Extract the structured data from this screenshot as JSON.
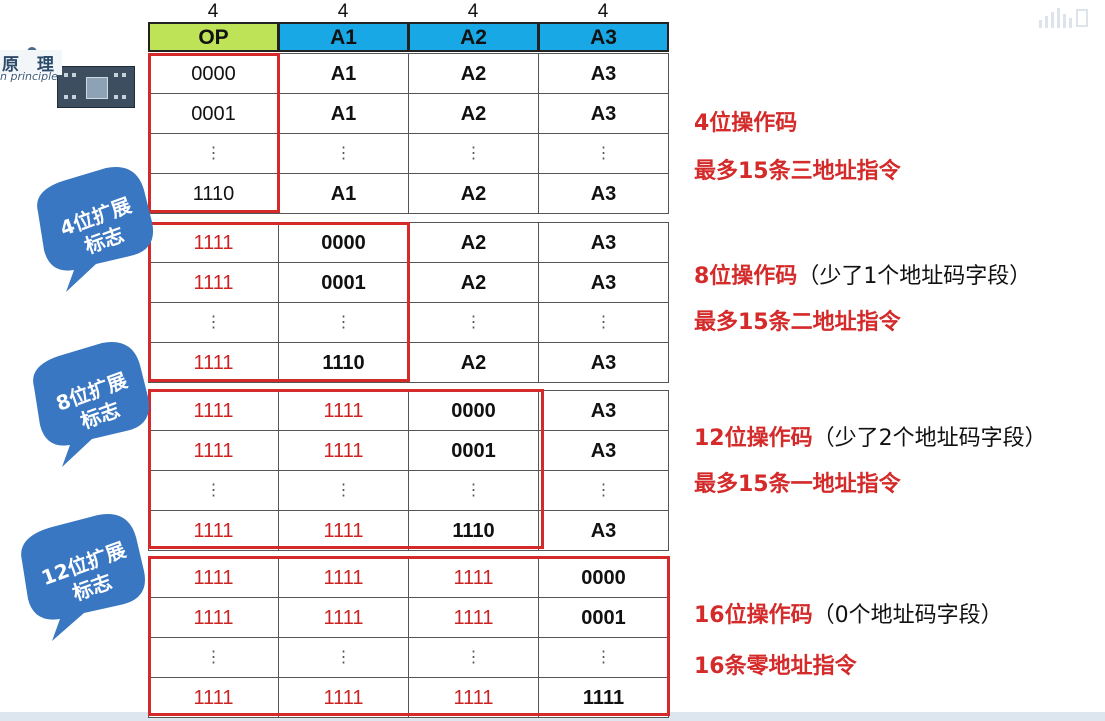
{
  "logo": {
    "title": "原 理",
    "subtitle": "n principle"
  },
  "bit_widths": [
    "4",
    "4",
    "4",
    "4"
  ],
  "columns": [
    "OP",
    "A1",
    "A2",
    "A3"
  ],
  "groups": [
    {
      "rows": [
        [
          "0000",
          "A1",
          "A2",
          "A3"
        ],
        [
          "0001",
          "A1",
          "A2",
          "A3"
        ],
        [
          "⋮",
          "⋮",
          "⋮",
          "⋮"
        ],
        [
          "1110",
          "A1",
          "A2",
          "A3"
        ]
      ],
      "note_title": "4位操作码",
      "note_paren": "",
      "note_count": "最多15条三地址指令"
    },
    {
      "rows": [
        [
          "1111",
          "0000",
          "A2",
          "A3"
        ],
        [
          "1111",
          "0001",
          "A2",
          "A3"
        ],
        [
          "⋮",
          "⋮",
          "⋮",
          "⋮"
        ],
        [
          "1111",
          "1110",
          "A2",
          "A3"
        ]
      ],
      "note_title": "8位操作码",
      "note_paren": "（少了1个地址码字段）",
      "note_count": "最多15条二地址指令",
      "callout": "4位扩展\n标志"
    },
    {
      "rows": [
        [
          "1111",
          "1111",
          "0000",
          "A3"
        ],
        [
          "1111",
          "1111",
          "0001",
          "A3"
        ],
        [
          "⋮",
          "⋮",
          "⋮",
          "⋮"
        ],
        [
          "1111",
          "1111",
          "1110",
          "A3"
        ]
      ],
      "note_title": "12位操作码",
      "note_paren": "（少了2个地址码字段）",
      "note_count": "最多15条一地址指令",
      "callout": "8位扩展\n标志"
    },
    {
      "rows": [
        [
          "1111",
          "1111",
          "1111",
          "0000"
        ],
        [
          "1111",
          "1111",
          "1111",
          "0001"
        ],
        [
          "⋮",
          "⋮",
          "⋮",
          "⋮"
        ],
        [
          "1111",
          "1111",
          "1111",
          "1111"
        ]
      ],
      "note_title": "16位操作码",
      "note_paren": "（0个地址码字段）",
      "note_count": "16条零地址指令",
      "callout": "12位扩展\n标志"
    }
  ],
  "colors": {
    "op_header": "#bfe356",
    "addr_header": "#18a8e6",
    "highlight": "#d42a2a",
    "callout": "#3a77c2"
  },
  "icons": [
    "chip-logo-icon",
    "audio-wave-icon"
  ]
}
